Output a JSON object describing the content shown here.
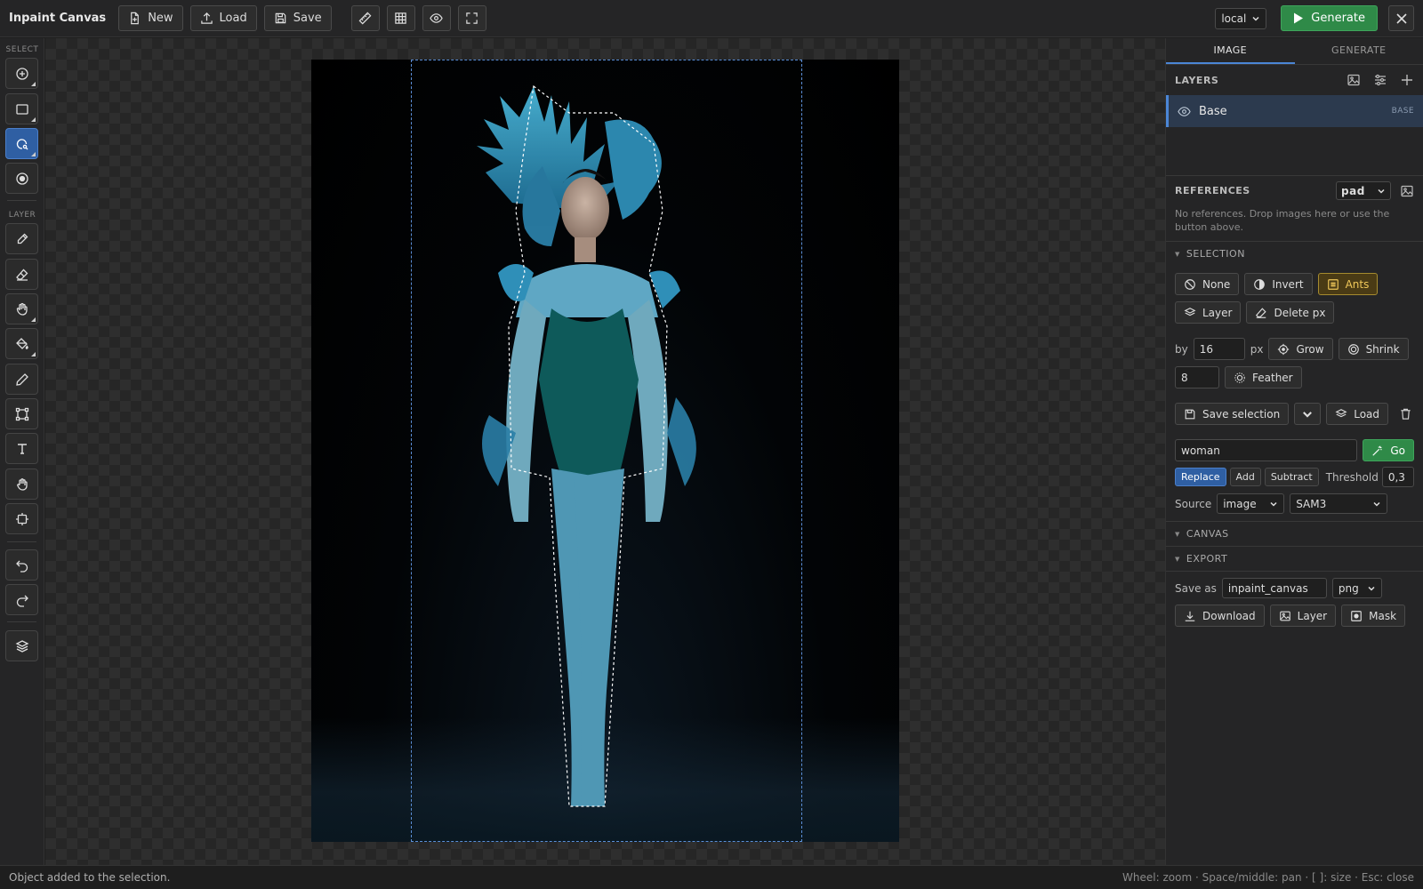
{
  "header": {
    "title": "Inpaint Canvas",
    "new_label": "New",
    "load_label": "Load",
    "save_label": "Save",
    "backend_select": "local",
    "generate_label": "Generate"
  },
  "toolbar": {
    "select_heading": "SELECT",
    "layer_heading": "LAYER"
  },
  "panel": {
    "tabs": [
      "IMAGE",
      "GENERATE"
    ],
    "layers_heading": "LAYERS",
    "layers": [
      {
        "name": "Base",
        "tag": "BASE"
      }
    ],
    "references_heading": "REFERENCES",
    "references_mode": "pad",
    "references_hint": "No references. Drop images here or use the button above.",
    "selection_heading": "SELECTION",
    "selection": {
      "none_label": "None",
      "invert_label": "Invert",
      "ants_label": "Ants",
      "layer_label": "Layer",
      "delete_px_label": "Delete px",
      "by_label": "by",
      "by_value": "16",
      "px_label": "px",
      "grow_label": "Grow",
      "shrink_label": "Shrink",
      "feather_value": "8",
      "feather_label": "Feather",
      "save_selection_label": "Save selection",
      "load_label": "Load",
      "prompt_value": "woman",
      "go_label": "Go",
      "mode_replace": "Replace",
      "mode_add": "Add",
      "mode_subtract": "Subtract",
      "threshold_label": "Threshold",
      "threshold_value": "0,3",
      "source_label": "Source",
      "source_value": "image",
      "model_value": "SAM3"
    },
    "canvas_heading": "CANVAS",
    "export_heading": "EXPORT",
    "export": {
      "save_as_label": "Save as",
      "filename": "inpaint_canvas",
      "format": "png",
      "download_label": "Download",
      "layer_label": "Layer",
      "mask_label": "Mask"
    }
  },
  "status": {
    "message": "Object added to the selection.",
    "hints": "Wheel: zoom · Space/middle: pan · [ ]: size · Esc: close"
  },
  "colors": {
    "accent": "#4b86d6",
    "generate": "#2f8a48",
    "ants_warn": "#f0c85a"
  }
}
